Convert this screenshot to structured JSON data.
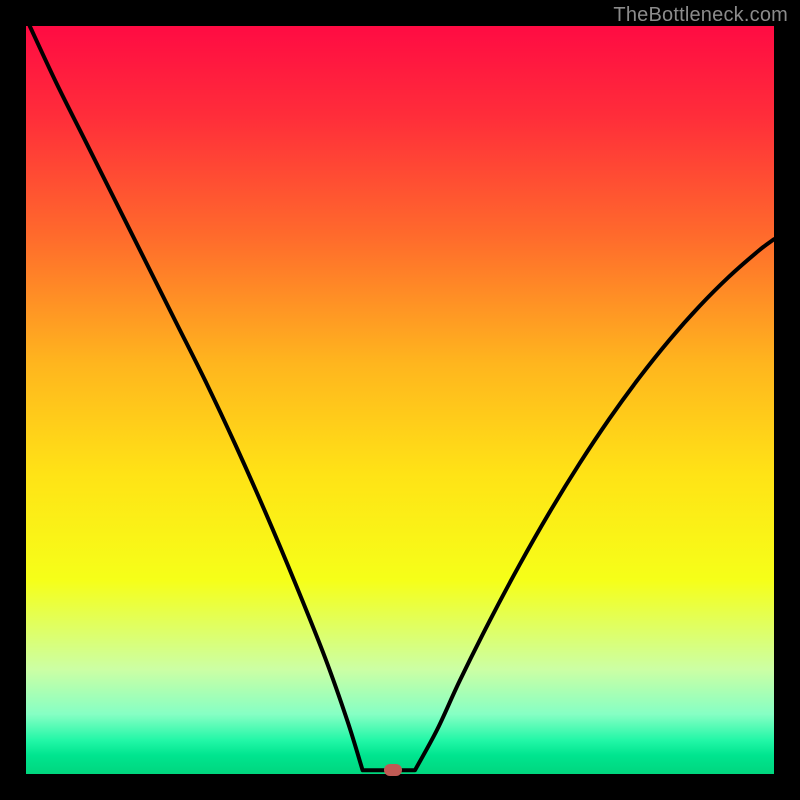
{
  "watermark": "TheBottleneck.com",
  "colors": {
    "gradient_stops": [
      {
        "offset": 0.0,
        "color": "#ff0b43"
      },
      {
        "offset": 0.12,
        "color": "#ff2d3a"
      },
      {
        "offset": 0.28,
        "color": "#ff6a2c"
      },
      {
        "offset": 0.45,
        "color": "#ffb51e"
      },
      {
        "offset": 0.6,
        "color": "#ffe316"
      },
      {
        "offset": 0.74,
        "color": "#f6ff18"
      },
      {
        "offset": 0.86,
        "color": "#ccffa4"
      },
      {
        "offset": 0.92,
        "color": "#86ffc4"
      },
      {
        "offset": 0.955,
        "color": "#22f7a7"
      },
      {
        "offset": 0.975,
        "color": "#00e58f"
      },
      {
        "offset": 1.0,
        "color": "#00d67e"
      }
    ],
    "curve_stroke": "#000000",
    "marker_fill": "#c05a54"
  },
  "chart_data": {
    "type": "line",
    "title": "",
    "xlabel": "",
    "ylabel": "",
    "xlim": [
      0,
      1
    ],
    "ylim": [
      0,
      1
    ],
    "optimum_x": 0.49,
    "flat_bottom": {
      "x0": 0.45,
      "x1": 0.52,
      "y": 0.005
    },
    "series": [
      {
        "name": "bottleneck-curve",
        "segment": "left",
        "x": [
          0.005,
          0.04,
          0.08,
          0.12,
          0.16,
          0.2,
          0.24,
          0.28,
          0.32,
          0.36,
          0.4,
          0.43,
          0.45
        ],
        "y": [
          1.0,
          0.925,
          0.845,
          0.765,
          0.685,
          0.605,
          0.525,
          0.44,
          0.35,
          0.255,
          0.155,
          0.07,
          0.005
        ]
      },
      {
        "name": "bottleneck-curve",
        "segment": "right",
        "x": [
          0.52,
          0.55,
          0.58,
          0.62,
          0.66,
          0.7,
          0.74,
          0.78,
          0.82,
          0.86,
          0.9,
          0.94,
          0.98,
          1.0
        ],
        "y": [
          0.005,
          0.06,
          0.125,
          0.205,
          0.28,
          0.35,
          0.415,
          0.475,
          0.53,
          0.58,
          0.625,
          0.665,
          0.7,
          0.715
        ]
      }
    ]
  }
}
